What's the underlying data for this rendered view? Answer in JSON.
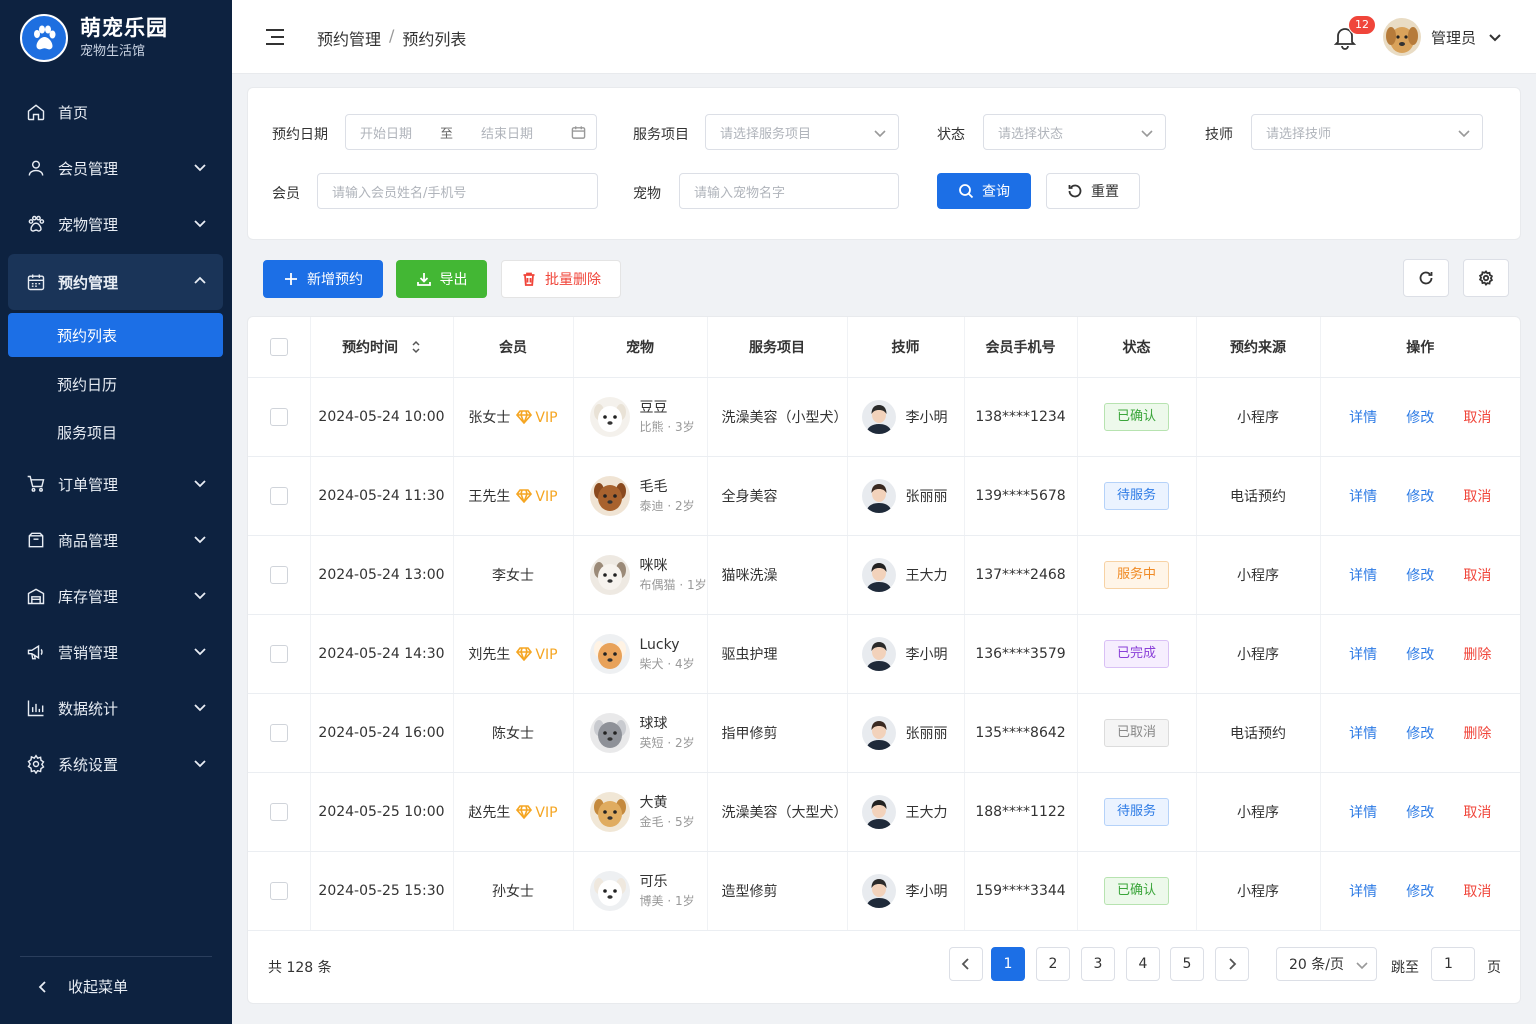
{
  "brand": {
    "name": "萌宠乐园",
    "subtitle": "宠物生活馆"
  },
  "sidebar": {
    "items": [
      {
        "label": "首页",
        "icon": "home-icon"
      },
      {
        "label": "会员管理",
        "icon": "user-icon"
      },
      {
        "label": "宠物管理",
        "icon": "paw-icon"
      },
      {
        "label": "预约管理",
        "icon": "calendar-icon",
        "expanded": true,
        "children": [
          {
            "label": "预约列表",
            "active": true
          },
          {
            "label": "预约日历"
          },
          {
            "label": "服务项目"
          }
        ]
      },
      {
        "label": "订单管理",
        "icon": "cart-icon"
      },
      {
        "label": "商品管理",
        "icon": "box-icon"
      },
      {
        "label": "库存管理",
        "icon": "warehouse-icon"
      },
      {
        "label": "营销管理",
        "icon": "megaphone-icon"
      },
      {
        "label": "数据统计",
        "icon": "bar-chart-icon"
      },
      {
        "label": "系统设置",
        "icon": "gear-icon"
      }
    ],
    "collapse_label": "收起菜单"
  },
  "header": {
    "breadcrumb": [
      "预约管理",
      "预约列表"
    ],
    "breadcrumb_sep": "/",
    "notification_count": "12",
    "user_name": "管理员"
  },
  "filters": {
    "date_label": "预约日期",
    "start_placeholder": "开始日期",
    "range_sep": "至",
    "end_placeholder": "结束日期",
    "service_label": "服务项目",
    "service_placeholder": "请选择服务项目",
    "status_label": "状态",
    "status_placeholder": "请选择状态",
    "tech_label": "技师",
    "tech_placeholder": "请选择技师",
    "member_label": "会员",
    "member_placeholder": "请输入会员姓名/手机号",
    "pet_label": "宠物",
    "pet_placeholder": "请输入宠物名字",
    "search_button": "查询",
    "reset_button": "重置"
  },
  "toolbar": {
    "add": "新增预约",
    "export": "导出",
    "batch_delete": "批量删除"
  },
  "table": {
    "columns": [
      "预约时间",
      "会员",
      "宠物",
      "服务项目",
      "技师",
      "会员手机号",
      "状态",
      "预约来源",
      "操作"
    ],
    "vip_label": "VIP",
    "rows": [
      {
        "time": "2024-05-24 10:00",
        "member": "张女士",
        "vip": true,
        "pet": "豆豆",
        "breed": "比熊 · 3岁",
        "service": "洗澡美容（小型犬）",
        "tech": "李小明",
        "phone": "138****1234",
        "status": "已确认",
        "status_type": "confirm",
        "source": "小程序",
        "ops": [
          "详情",
          "修改",
          "取消"
        ]
      },
      {
        "time": "2024-05-24 11:30",
        "member": "王先生",
        "vip": true,
        "pet": "毛毛",
        "breed": "泰迪 · 2岁",
        "service": "全身美容",
        "tech": "张丽丽",
        "phone": "139****5678",
        "status": "待服务",
        "status_type": "wait",
        "source": "电话预约",
        "ops": [
          "详情",
          "修改",
          "取消"
        ]
      },
      {
        "time": "2024-05-24 13:00",
        "member": "李女士",
        "vip": false,
        "pet": "咪咪",
        "breed": "布偶猫 · 1岁",
        "service": "猫咪洗澡",
        "tech": "王大力",
        "phone": "137****2468",
        "status": "服务中",
        "status_type": "serving",
        "source": "小程序",
        "ops": [
          "详情",
          "修改",
          "取消"
        ]
      },
      {
        "time": "2024-05-24 14:30",
        "member": "刘先生",
        "vip": true,
        "pet": "Lucky",
        "breed": "柴犬 · 4岁",
        "service": "驱虫护理",
        "tech": "李小明",
        "phone": "136****3579",
        "status": "已完成",
        "status_type": "done",
        "source": "小程序",
        "ops": [
          "详情",
          "修改",
          "删除"
        ]
      },
      {
        "time": "2024-05-24 16:00",
        "member": "陈女士",
        "vip": false,
        "pet": "球球",
        "breed": "英短 · 2岁",
        "service": "指甲修剪",
        "tech": "张丽丽",
        "phone": "135****8642",
        "status": "已取消",
        "status_type": "cancel",
        "source": "电话预约",
        "ops": [
          "详情",
          "修改",
          "删除"
        ]
      },
      {
        "time": "2024-05-25 10:00",
        "member": "赵先生",
        "vip": true,
        "pet": "大黄",
        "breed": "金毛 · 5岁",
        "service": "洗澡美容（大型犬）",
        "tech": "王大力",
        "phone": "188****1122",
        "status": "待服务",
        "status_type": "wait",
        "source": "小程序",
        "ops": [
          "详情",
          "修改",
          "取消"
        ]
      },
      {
        "time": "2024-05-25 15:30",
        "member": "孙女士",
        "vip": false,
        "pet": "可乐",
        "breed": "博美 · 1岁",
        "service": "造型修剪",
        "tech": "李小明",
        "phone": "159****3344",
        "status": "已确认",
        "status_type": "confirm",
        "source": "小程序",
        "ops": [
          "详情",
          "修改",
          "取消"
        ]
      }
    ]
  },
  "pagination": {
    "total": "共 128 条",
    "pages": [
      "1",
      "2",
      "3",
      "4",
      "5"
    ],
    "current": "1",
    "page_size": "20 条/页",
    "jump_label": "跳至",
    "jump_value": "1",
    "page_suffix": "页"
  },
  "colors": {
    "primary": "#1c6fe6",
    "sidebar_bg": "#0d2240",
    "success": "#43b734",
    "danger": "#f0453a",
    "vip": "#f5a623"
  }
}
